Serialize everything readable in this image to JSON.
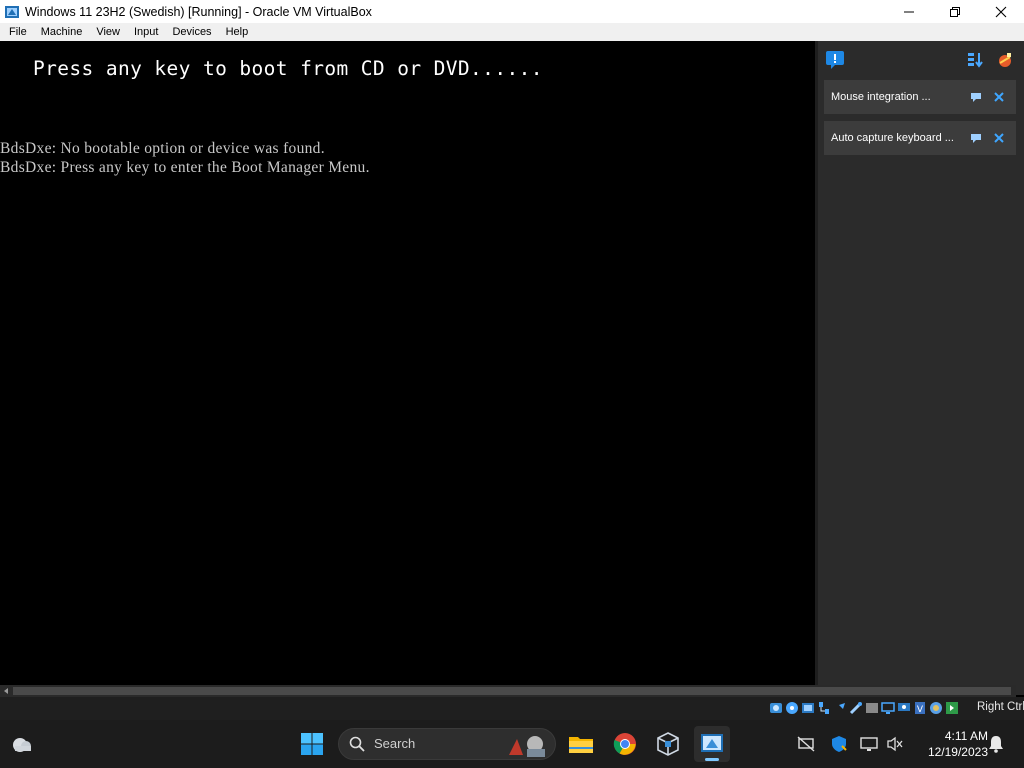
{
  "window": {
    "title": "Windows 11 23H2 (Swedish) [Running] - Oracle VM VirtualBox"
  },
  "menu": {
    "items": [
      {
        "label": "File"
      },
      {
        "label": "Machine"
      },
      {
        "label": "View"
      },
      {
        "label": "Input"
      },
      {
        "label": "Devices"
      },
      {
        "label": "Help"
      }
    ]
  },
  "vm_screen": {
    "boot_prompt": "Press any key to boot from CD or DVD......",
    "lines": [
      "BdsDxe: No bootable option or device was found.",
      "BdsDxe: Press any key to enter the Boot Manager Menu."
    ]
  },
  "notification_center": {
    "notifications": [
      {
        "text": "Mouse integration ..."
      },
      {
        "text": "Auto capture keyboard ..."
      }
    ]
  },
  "statusbar": {
    "host_key": "Right Ctrl",
    "icons": [
      "hard-disk-icon",
      "optical-drive-icon",
      "audio-icon",
      "network-icon",
      "usb-icon",
      "shared-folders-icon",
      "display-icon",
      "recording-icon",
      "vt-x-icon",
      "guest-additions-icon",
      "mouse-integration-icon"
    ]
  },
  "taskbar": {
    "search_label": "Search",
    "clock": {
      "time": "4:11 AM",
      "date": "12/19/2023"
    },
    "apps": [
      "file-explorer",
      "google-chrome",
      "virtualbox-manager",
      "virtualbox-vm"
    ]
  },
  "colors": {
    "vm_background": "#000000",
    "panel_background": "#2b2b2b",
    "notification_background": "#3c3c3c",
    "accent_blue": "#3ea6ff",
    "taskbar": "#1c1c1c"
  }
}
